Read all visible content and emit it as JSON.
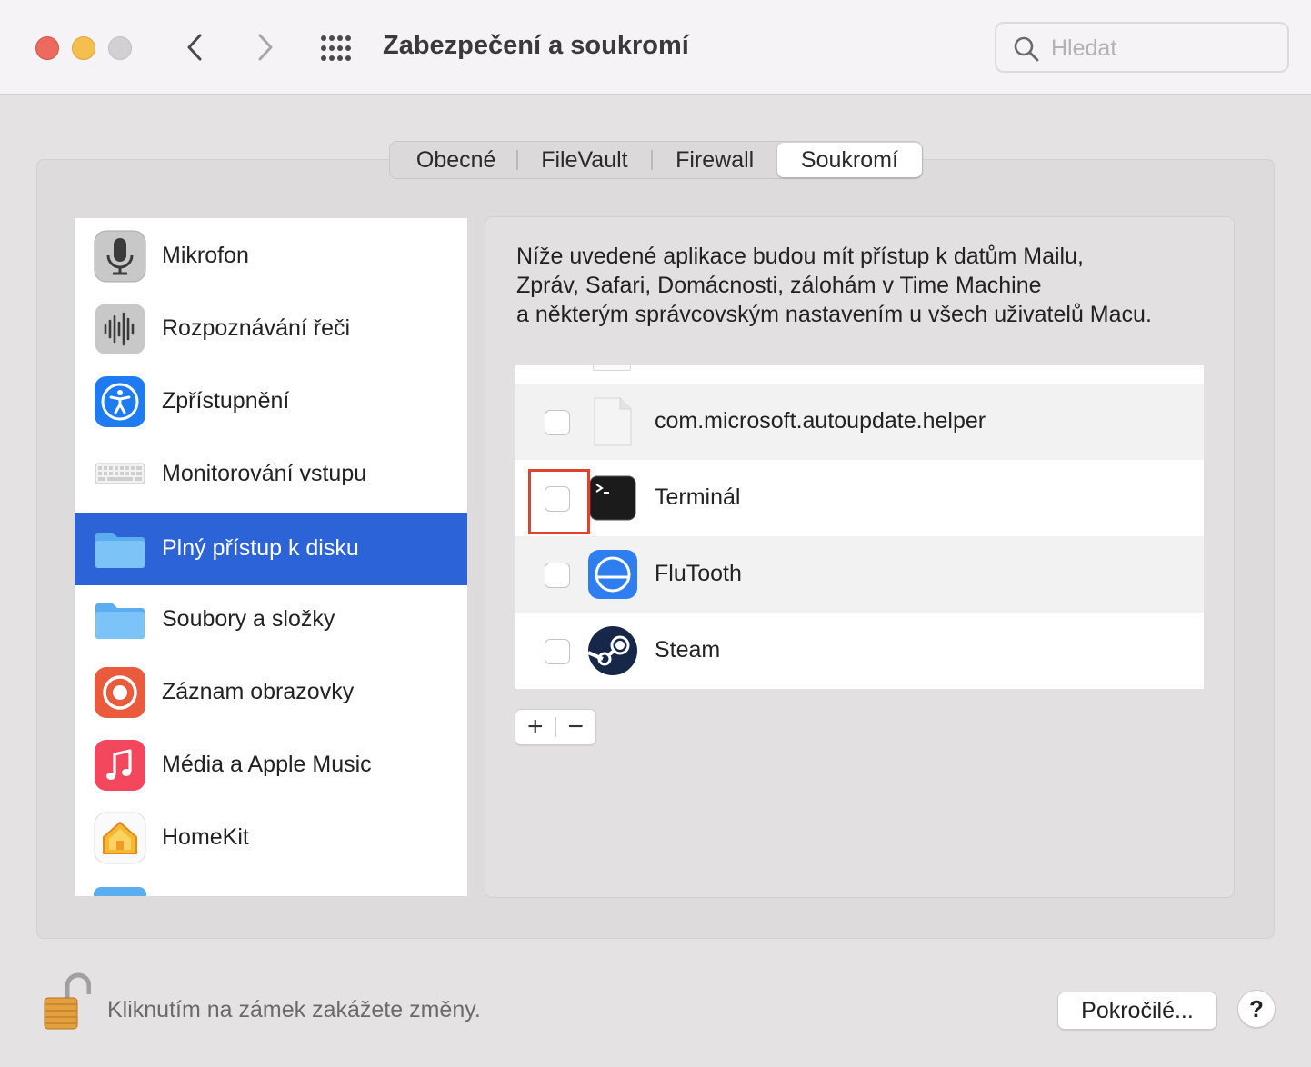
{
  "window": {
    "title": "Zabezpečení a soukromí",
    "search_placeholder": "Hledat"
  },
  "tabs": [
    {
      "label": "Obecné",
      "selected": false
    },
    {
      "label": "FileVault",
      "selected": false
    },
    {
      "label": "Firewall",
      "selected": false
    },
    {
      "label": "Soukromí",
      "selected": true
    }
  ],
  "sidebar": {
    "items": [
      {
        "label": "Mikrofon",
        "icon": "microphone-icon",
        "selected": false
      },
      {
        "label": "Rozpoznávání řeči",
        "icon": "speech-recognition-icon",
        "selected": false
      },
      {
        "label": "Zpřístupnění",
        "icon": "accessibility-icon",
        "selected": false
      },
      {
        "label": "Monitorování vstupu",
        "icon": "keyboard-icon",
        "selected": false
      },
      {
        "label": "Plný přístup k disku",
        "icon": "folder-icon",
        "selected": true
      },
      {
        "label": "Soubory a složky",
        "icon": "folder-icon",
        "selected": false
      },
      {
        "label": "Záznam obrazovky",
        "icon": "screen-recording-icon",
        "selected": false
      },
      {
        "label": "Média a Apple Music",
        "icon": "music-icon",
        "selected": false
      },
      {
        "label": "HomeKit",
        "icon": "homekit-icon",
        "selected": false
      }
    ]
  },
  "main": {
    "description_lines": [
      "Níže uvedené aplikace budou mít přístup k datům Mailu,",
      "Zpráv, Safari, Domácnosti, zálohám v Time Machine",
      "a některým správcovským nastavením u všech uživatelů Macu."
    ],
    "apps": [
      {
        "label": "com.microsoft.autoupdate.helper",
        "icon": "document-icon",
        "checked": false
      },
      {
        "label": "Terminál",
        "icon": "terminal-icon",
        "checked": false
      },
      {
        "label": "FluTooth",
        "icon": "flutooth-icon",
        "checked": false
      },
      {
        "label": "Steam",
        "icon": "steam-icon",
        "checked": false
      }
    ],
    "add_label": "+",
    "remove_label": "−"
  },
  "footer": {
    "lock_text": "Kliknutím na zámek zakážete změny.",
    "advanced_label": "Pokročilé...",
    "help_label": "?"
  },
  "colors": {
    "selection": "#2c64d7",
    "highlight_box": "#e0442e"
  }
}
